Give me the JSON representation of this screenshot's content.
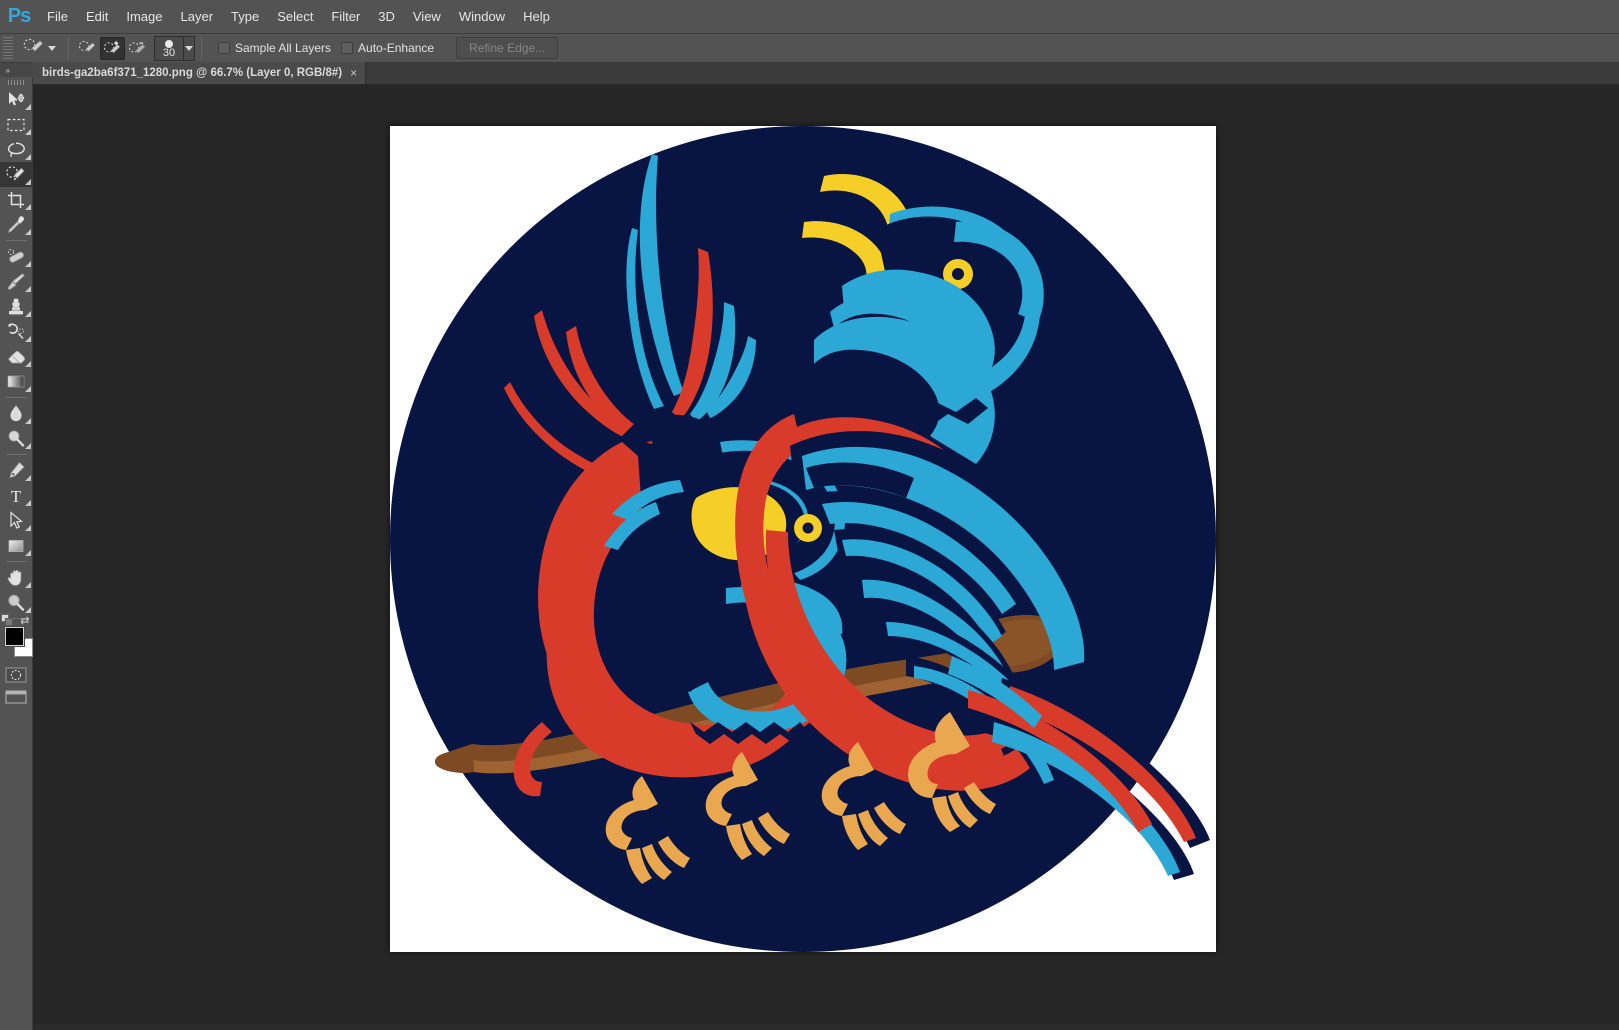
{
  "app": {
    "name": "Adobe Photoshop",
    "logo_text": "Ps",
    "logo_color": "#31a8e0"
  },
  "menubar": {
    "items": [
      {
        "label": "File"
      },
      {
        "label": "Edit"
      },
      {
        "label": "Image"
      },
      {
        "label": "Layer"
      },
      {
        "label": "Type"
      },
      {
        "label": "Select"
      },
      {
        "label": "Filter"
      },
      {
        "label": "3D"
      },
      {
        "label": "View"
      },
      {
        "label": "Window"
      },
      {
        "label": "Help"
      }
    ]
  },
  "options_bar": {
    "tool": "Quick Selection Tool",
    "modes": [
      {
        "name": "new-selection",
        "label": "New selection",
        "active": false
      },
      {
        "name": "add-to-selection",
        "label": "Add to selection",
        "active": true
      },
      {
        "name": "subtract-from-selection",
        "label": "Subtract from selection",
        "active": false
      }
    ],
    "brush_size": "30",
    "sample_all_layers": {
      "label": "Sample All Layers",
      "checked": false
    },
    "auto_enhance": {
      "label": "Auto-Enhance",
      "checked": false
    },
    "refine_edge": {
      "label": "Refine Edge...",
      "enabled": false
    }
  },
  "document": {
    "tab_title": "birds-ga2ba6f371_1280.png @ 66.7% (Layer 0, RGB/8#)",
    "filename": "birds-ga2ba6f371_1280.png",
    "zoom": "66.7%",
    "layer": "Layer 0",
    "color_mode": "RGB/8#",
    "close_glyph": "×"
  },
  "toolbar": {
    "collapse_glyph": "»",
    "tools": [
      {
        "name": "move-tool",
        "label": "Move Tool",
        "selected": false
      },
      {
        "name": "rectangular-marquee-tool",
        "label": "Rectangular Marquee Tool",
        "selected": false
      },
      {
        "name": "lasso-tool",
        "label": "Lasso Tool",
        "selected": false
      },
      {
        "name": "quick-selection-tool",
        "label": "Quick Selection Tool",
        "selected": true
      },
      {
        "name": "crop-tool",
        "label": "Crop Tool",
        "selected": false
      },
      {
        "name": "eyedropper-tool",
        "label": "Eyedropper Tool",
        "selected": false
      },
      {
        "name": "spot-healing-brush-tool",
        "label": "Spot Healing Brush Tool",
        "selected": false
      },
      {
        "name": "brush-tool",
        "label": "Brush Tool",
        "selected": false
      },
      {
        "name": "clone-stamp-tool",
        "label": "Clone Stamp Tool",
        "selected": false
      },
      {
        "name": "history-brush-tool",
        "label": "History Brush Tool",
        "selected": false
      },
      {
        "name": "eraser-tool",
        "label": "Eraser Tool",
        "selected": false
      },
      {
        "name": "gradient-tool",
        "label": "Gradient Tool",
        "selected": false
      },
      {
        "name": "blur-tool",
        "label": "Blur Tool",
        "selected": false
      },
      {
        "name": "dodge-tool",
        "label": "Dodge Tool",
        "selected": false
      },
      {
        "name": "pen-tool",
        "label": "Pen Tool",
        "selected": false
      },
      {
        "name": "horizontal-type-tool",
        "label": "Horizontal Type Tool",
        "selected": false
      },
      {
        "name": "path-selection-tool",
        "label": "Path Selection Tool",
        "selected": false
      },
      {
        "name": "rectangle-tool",
        "label": "Rectangle Tool",
        "selected": false
      },
      {
        "name": "hand-tool",
        "label": "Hand Tool",
        "selected": false
      },
      {
        "name": "zoom-tool",
        "label": "Zoom Tool",
        "selected": false
      }
    ],
    "foreground_color": "#000000",
    "background_color": "#ffffff",
    "swap_colors_glyph": "⇄",
    "quick_mask_label": "Edit in Quick Mask Mode",
    "screen_mode_label": "Change Screen Mode"
  },
  "artwork": {
    "title": "Two stylized birds perched on a branch",
    "background_color": "#ffffff",
    "circle_color": "#081543",
    "palette": {
      "navy": "#081543",
      "red": "#d93b2b",
      "cyan": "#2ba8d6",
      "yellow": "#f5ce28",
      "branch_dark": "#8a5a2b",
      "branch_light": "#9e6330",
      "foot": "#e9a84f"
    }
  }
}
